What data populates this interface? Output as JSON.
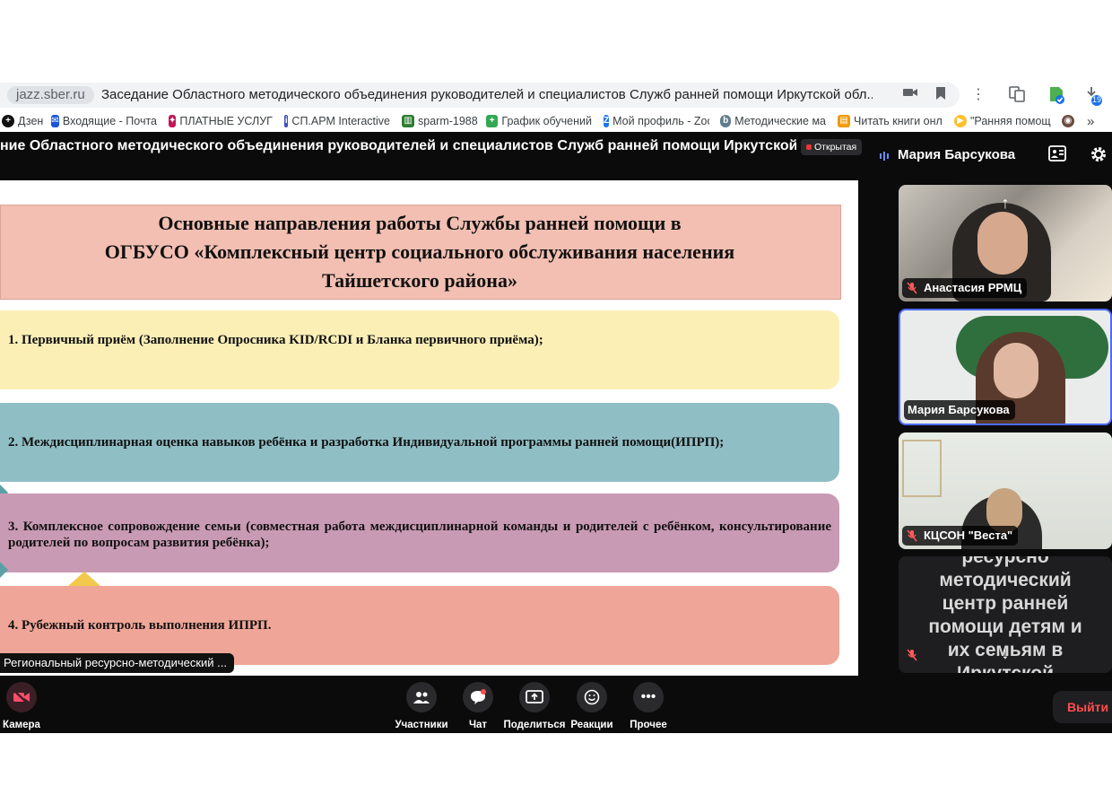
{
  "browser": {
    "domain": "jazz.sber.ru",
    "page_title": "Заседание Областного методического объединения руководителей и специалистов Служб ранней помощи Иркутской обл...",
    "download_count": "19"
  },
  "bookmarks": [
    {
      "label": "Дзен",
      "icon": "dzen-icon",
      "color": "#111111"
    },
    {
      "label": "Входящие - Почта",
      "icon": "mail-icon",
      "color": "#1a56db"
    },
    {
      "label": "ПЛАТНЫЕ УСЛУГИ",
      "icon": "service-icon",
      "color": "#c2185b"
    },
    {
      "label": "СП.АРМ Interactive",
      "icon": "info-icon",
      "color": "#3f51b5"
    },
    {
      "label": "sparm-1988",
      "icon": "sparm-icon",
      "color": "#2e7d32"
    },
    {
      "label": "График обучений",
      "icon": "plus-icon",
      "color": "#34a853"
    },
    {
      "label": "Мой профиль - Zoom",
      "icon": "zoom-icon",
      "color": "#1a73e8"
    },
    {
      "label": "Методические ма",
      "icon": "b-icon",
      "color": "#607d8b"
    },
    {
      "label": "Читать книги онл",
      "icon": "book-icon",
      "color": "#f29900"
    },
    {
      "label": "\"Ранняя помощ",
      "icon": "play-icon",
      "color": "#fbc02d"
    }
  ],
  "meeting": {
    "title": "ние Областного методического объединения руководителей и специалистов Служб ранней помощи Иркутской обла...",
    "badge": "Открытая",
    "active_speaker": "Мария Барсукова",
    "presenter_label": "Региональный ресурсно-методический ..."
  },
  "slide": {
    "title_lines": [
      "Основные направления работы Службы ранней помощи в",
      "ОГБУСО «Комплексный центр социального обслуживания населения",
      "Тайшетского района»"
    ],
    "items": [
      {
        "text": "1. Первичный приём (Заполнение Опросника KID/RCDI и Бланка первичного приёма);",
        "color": "#fbefb6"
      },
      {
        "text": "2. Междисциплинарная оценка навыков ребёнка и разработка Индивидуальной программы ранней помощи(ИПРП);",
        "color": "#8fbfc5"
      },
      {
        "text": "3. Комплексное сопровождение семьи (совместная работа междисциплинарной команды и родителей с ребёнком, консультирование родителей по вопросам развития ребёнка);",
        "color": "#c99ab4"
      },
      {
        "text": "4. Рубежный контроль выполнения ИПРП.",
        "color": "#efa597"
      }
    ]
  },
  "participants": [
    {
      "name": "Анастасия РРМЦ",
      "muted": true
    },
    {
      "name": "Мария Барсукова",
      "muted": false
    },
    {
      "name": "КЦСОН \"Веста\"",
      "muted": true
    },
    {
      "name": "",
      "muted": true,
      "text_lines": [
        "ресурсно",
        "методический",
        "центр ранней",
        "помощи детям и",
        "их семьям в",
        "Иркутской"
      ]
    }
  ],
  "controls": {
    "camera": "Камера",
    "participants": "Участники",
    "chat": "Чат",
    "share": "Поделиться",
    "reactions": "Реакции",
    "more": "Прочее",
    "leave": "Выйти"
  }
}
